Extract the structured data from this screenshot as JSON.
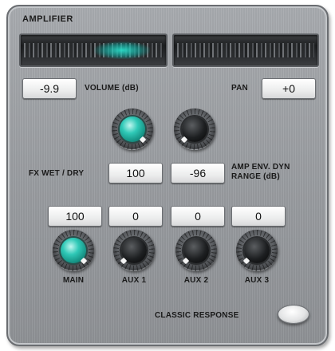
{
  "amplifier": {
    "title": "AMPLIFIER",
    "volume": {
      "value": "-9.9",
      "label": "VOLUME (dB)"
    },
    "pan": {
      "value": "+0",
      "label": "PAN"
    },
    "fx_wet_dry": {
      "value": "100",
      "label": "FX WET / DRY"
    },
    "amp_env_dyn_range": {
      "value": "-96",
      "label_line1": "AMP ENV. DYN",
      "label_line2": "RANGE (dB)"
    },
    "outputs": [
      {
        "label": "MAIN",
        "value": "100"
      },
      {
        "label": "AUX 1",
        "value": "0"
      },
      {
        "label": "AUX 2",
        "value": "0"
      },
      {
        "label": "AUX 3",
        "value": "0"
      }
    ],
    "classic_response": {
      "label": "CLASSIC RESPONSE"
    }
  },
  "colors": {
    "accent_teal": "#2fc9b7",
    "panel": "#9b9ea2"
  },
  "icons": {
    "knob": "rotary-knob-icon"
  }
}
